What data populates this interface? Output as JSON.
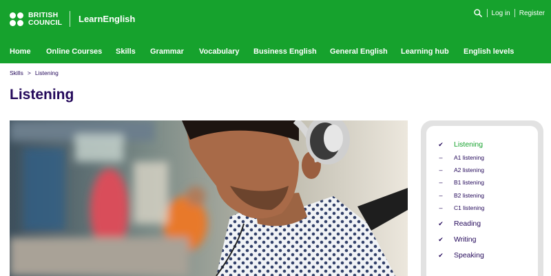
{
  "header": {
    "logo_line1": "BRITISH",
    "logo_line2": "COUNCIL",
    "product": "LearnEnglish",
    "login": "Log in",
    "register": "Register",
    "search_icon": "search-icon"
  },
  "nav": {
    "items": [
      "Home",
      "Online Courses",
      "Skills",
      "Grammar",
      "Vocabulary",
      "Business English",
      "General English",
      "Learning hub",
      "English levels"
    ]
  },
  "breadcrumb": {
    "crumb1": "Skills",
    "separator": ">",
    "crumb2": "Listening"
  },
  "page": {
    "title": "Listening"
  },
  "sidebar": {
    "items": [
      {
        "label": "Listening",
        "mark": "✔",
        "type": "main",
        "active": true
      },
      {
        "label": "A1 listening",
        "mark": "–",
        "type": "sub"
      },
      {
        "label": "A2 listening",
        "mark": "–",
        "type": "sub"
      },
      {
        "label": "B1 listening",
        "mark": "–",
        "type": "sub"
      },
      {
        "label": "B2 listening",
        "mark": "–",
        "type": "sub"
      },
      {
        "label": "C1 listening",
        "mark": "–",
        "type": "sub"
      },
      {
        "label": "Reading",
        "mark": "✔",
        "type": "main"
      },
      {
        "label": "Writing",
        "mark": "✔",
        "type": "main"
      },
      {
        "label": "Speaking",
        "mark": "✔",
        "type": "main"
      }
    ]
  },
  "colors": {
    "brand_green": "#16a22d",
    "text_navy": "#23085a",
    "panel_grey": "#e2e2e2"
  }
}
